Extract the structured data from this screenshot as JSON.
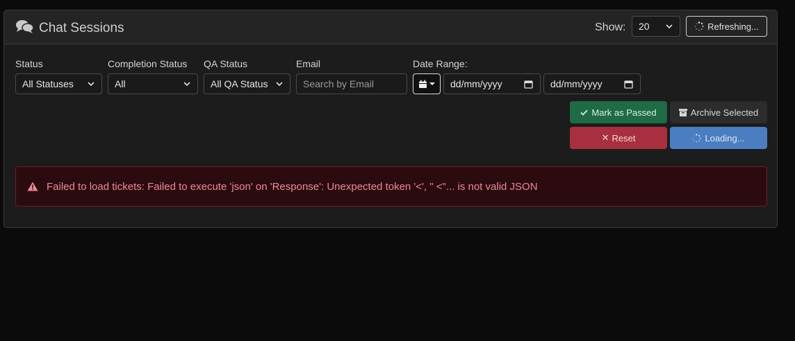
{
  "header": {
    "title": "Chat Sessions",
    "show_label": "Show:",
    "page_size": "20",
    "refresh_label": "Refreshing..."
  },
  "filters": {
    "status": {
      "label": "Status",
      "value": "All Statuses"
    },
    "completion": {
      "label": "Completion Status",
      "value": "All"
    },
    "qa": {
      "label": "QA Status",
      "value": "All QA Status"
    },
    "email": {
      "label": "Email",
      "placeholder": "Search by Email"
    },
    "date_range": {
      "label": "Date Range:",
      "from_placeholder": "dd/mm/yyyy",
      "to_placeholder": "dd/mm/yyyy"
    }
  },
  "actions": {
    "mark_passed": "Mark as Passed",
    "archive": "Archive Selected",
    "reset": "Reset",
    "loading": "Loading..."
  },
  "alert": {
    "message": "Failed to load tickets: Failed to execute 'json' on 'Response': Unexpected token '<', \" <\"... is not valid JSON"
  },
  "colors": {
    "background": "#0b0b0b",
    "card": "#1c1c1c",
    "success": "#1e6b45",
    "danger": "#a8303e",
    "primary": "#4a7ec0",
    "alert_text": "#ea8b95"
  },
  "icons": [
    "comments-icon",
    "spinner-icon",
    "chevron-down-icon",
    "calendar-icon",
    "check-icon",
    "archive-icon",
    "close-icon",
    "warning-icon"
  ]
}
